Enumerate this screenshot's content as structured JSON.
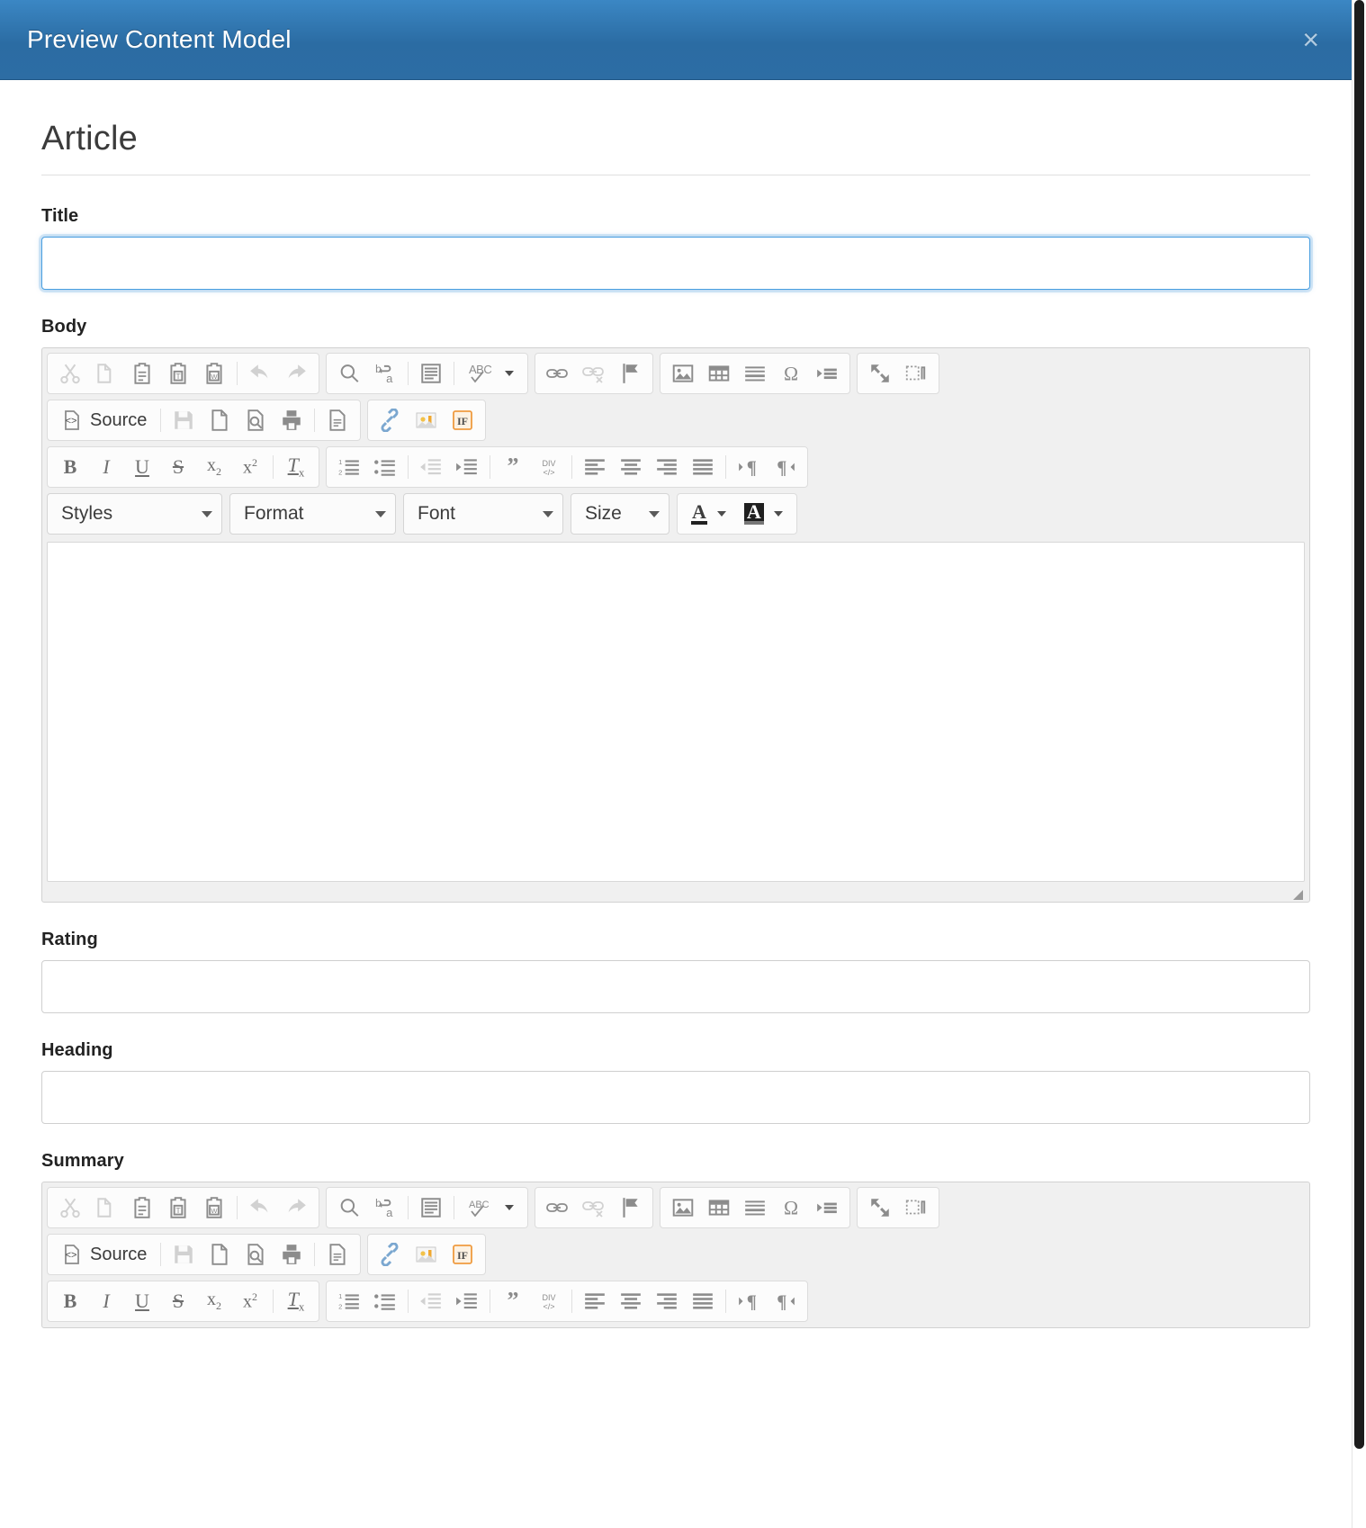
{
  "modal": {
    "title": "Preview Content Model",
    "close_label": "×",
    "header_color": "#2b6ca3"
  },
  "form": {
    "heading": "Article",
    "fields": [
      {
        "label": "Title",
        "type": "text",
        "value": "",
        "focused": true
      },
      {
        "label": "Body",
        "type": "richtext",
        "value": ""
      },
      {
        "label": "Rating",
        "type": "text",
        "value": "",
        "focused": false
      },
      {
        "label": "Heading",
        "type": "text",
        "value": "",
        "focused": false
      },
      {
        "label": "Summary",
        "type": "richtext",
        "value": ""
      }
    ]
  },
  "editor": {
    "source_label": "Source",
    "combos": [
      {
        "name": "styles",
        "label": "Styles"
      },
      {
        "name": "format",
        "label": "Format"
      },
      {
        "name": "font",
        "label": "Font"
      },
      {
        "name": "size",
        "label": "Size"
      }
    ],
    "row1": [
      {
        "group": "clipboard",
        "buttons": [
          {
            "icon": "cut-icon",
            "title": "Cut",
            "disabled": true
          },
          {
            "icon": "copy-icon",
            "title": "Copy",
            "disabled": true
          },
          {
            "icon": "paste-icon",
            "title": "Paste"
          },
          {
            "icon": "paste-text-icon",
            "title": "Paste as plain text"
          },
          {
            "icon": "paste-word-icon",
            "title": "Paste from Word"
          },
          {
            "sep": true
          },
          {
            "icon": "undo-icon",
            "title": "Undo",
            "disabled": true
          },
          {
            "icon": "redo-icon",
            "title": "Redo",
            "disabled": true
          }
        ]
      },
      {
        "group": "editing",
        "buttons": [
          {
            "icon": "find-icon",
            "title": "Find"
          },
          {
            "icon": "replace-icon",
            "title": "Replace"
          },
          {
            "sep": true
          },
          {
            "icon": "select-all-icon",
            "title": "Select All"
          },
          {
            "sep": true
          },
          {
            "icon": "spellcheck-icon",
            "title": "Spell Check As You Type",
            "caret": true
          }
        ]
      },
      {
        "group": "links",
        "buttons": [
          {
            "icon": "link-icon",
            "title": "Link"
          },
          {
            "icon": "unlink-icon",
            "title": "Unlink",
            "disabled": true
          },
          {
            "icon": "anchor-flag-icon",
            "title": "Anchor"
          }
        ]
      },
      {
        "group": "insert",
        "buttons": [
          {
            "icon": "image-icon",
            "title": "Image"
          },
          {
            "icon": "table-icon",
            "title": "Table"
          },
          {
            "icon": "horizontal-rule-icon",
            "title": "Horizontal Line"
          },
          {
            "icon": "special-char-icon",
            "title": "Insert Special Character"
          },
          {
            "icon": "page-break-icon",
            "title": "Page Break"
          }
        ]
      },
      {
        "group": "tools",
        "buttons": [
          {
            "icon": "maximize-icon",
            "title": "Maximize"
          },
          {
            "icon": "show-blocks-icon",
            "title": "Show Blocks"
          }
        ]
      }
    ],
    "row2": [
      {
        "group": "document",
        "buttons": [
          {
            "icon": "source-icon",
            "title": "Source",
            "label": "Source"
          },
          {
            "sep": true
          },
          {
            "icon": "save-icon",
            "title": "Save",
            "disabled": true
          },
          {
            "icon": "new-page-icon",
            "title": "New Page"
          },
          {
            "icon": "preview-icon",
            "title": "Preview"
          },
          {
            "icon": "print-icon",
            "title": "Print"
          },
          {
            "sep": true
          },
          {
            "icon": "templates-icon",
            "title": "Templates"
          }
        ]
      },
      {
        "group": "plugins",
        "buttons": [
          {
            "icon": "linkit-icon",
            "title": "Link to content"
          },
          {
            "icon": "media-browser-icon",
            "title": "Media browser"
          },
          {
            "icon": "if-token-icon",
            "title": "IF token"
          }
        ]
      }
    ],
    "row3": [
      {
        "group": "basicstyles",
        "buttons": [
          {
            "icon": "bold-icon",
            "title": "Bold"
          },
          {
            "icon": "italic-icon",
            "title": "Italic"
          },
          {
            "icon": "underline-icon",
            "title": "Underline"
          },
          {
            "icon": "strike-icon",
            "title": "Strikethrough"
          },
          {
            "icon": "subscript-icon",
            "title": "Subscript"
          },
          {
            "icon": "superscript-icon",
            "title": "Superscript"
          },
          {
            "sep": true
          },
          {
            "icon": "remove-format-icon",
            "title": "Remove Format"
          }
        ]
      },
      {
        "group": "paragraph",
        "buttons": [
          {
            "icon": "numbered-list-icon",
            "title": "Insert/Remove Numbered List"
          },
          {
            "icon": "bulleted-list-icon",
            "title": "Insert/Remove Bulleted List"
          },
          {
            "sep": true
          },
          {
            "icon": "outdent-icon",
            "title": "Decrease Indent",
            "disabled": true
          },
          {
            "icon": "indent-icon",
            "title": "Increase Indent"
          },
          {
            "sep": true
          },
          {
            "icon": "blockquote-icon",
            "title": "Block Quote"
          },
          {
            "icon": "div-container-icon",
            "title": "Create Div Container"
          },
          {
            "sep": true
          },
          {
            "icon": "align-left-icon",
            "title": "Align Left"
          },
          {
            "icon": "align-center-icon",
            "title": "Center"
          },
          {
            "icon": "align-right-icon",
            "title": "Align Right"
          },
          {
            "icon": "justify-icon",
            "title": "Justify"
          },
          {
            "sep": true
          },
          {
            "icon": "ltr-icon",
            "title": "Text direction from left to right"
          },
          {
            "icon": "rtl-icon",
            "title": "Text direction from right to left"
          }
        ]
      }
    ],
    "colors": [
      {
        "icon": "text-color-icon",
        "title": "Text Color",
        "caret": true
      },
      {
        "icon": "background-color-icon",
        "title": "Background Color",
        "caret": true
      }
    ]
  }
}
